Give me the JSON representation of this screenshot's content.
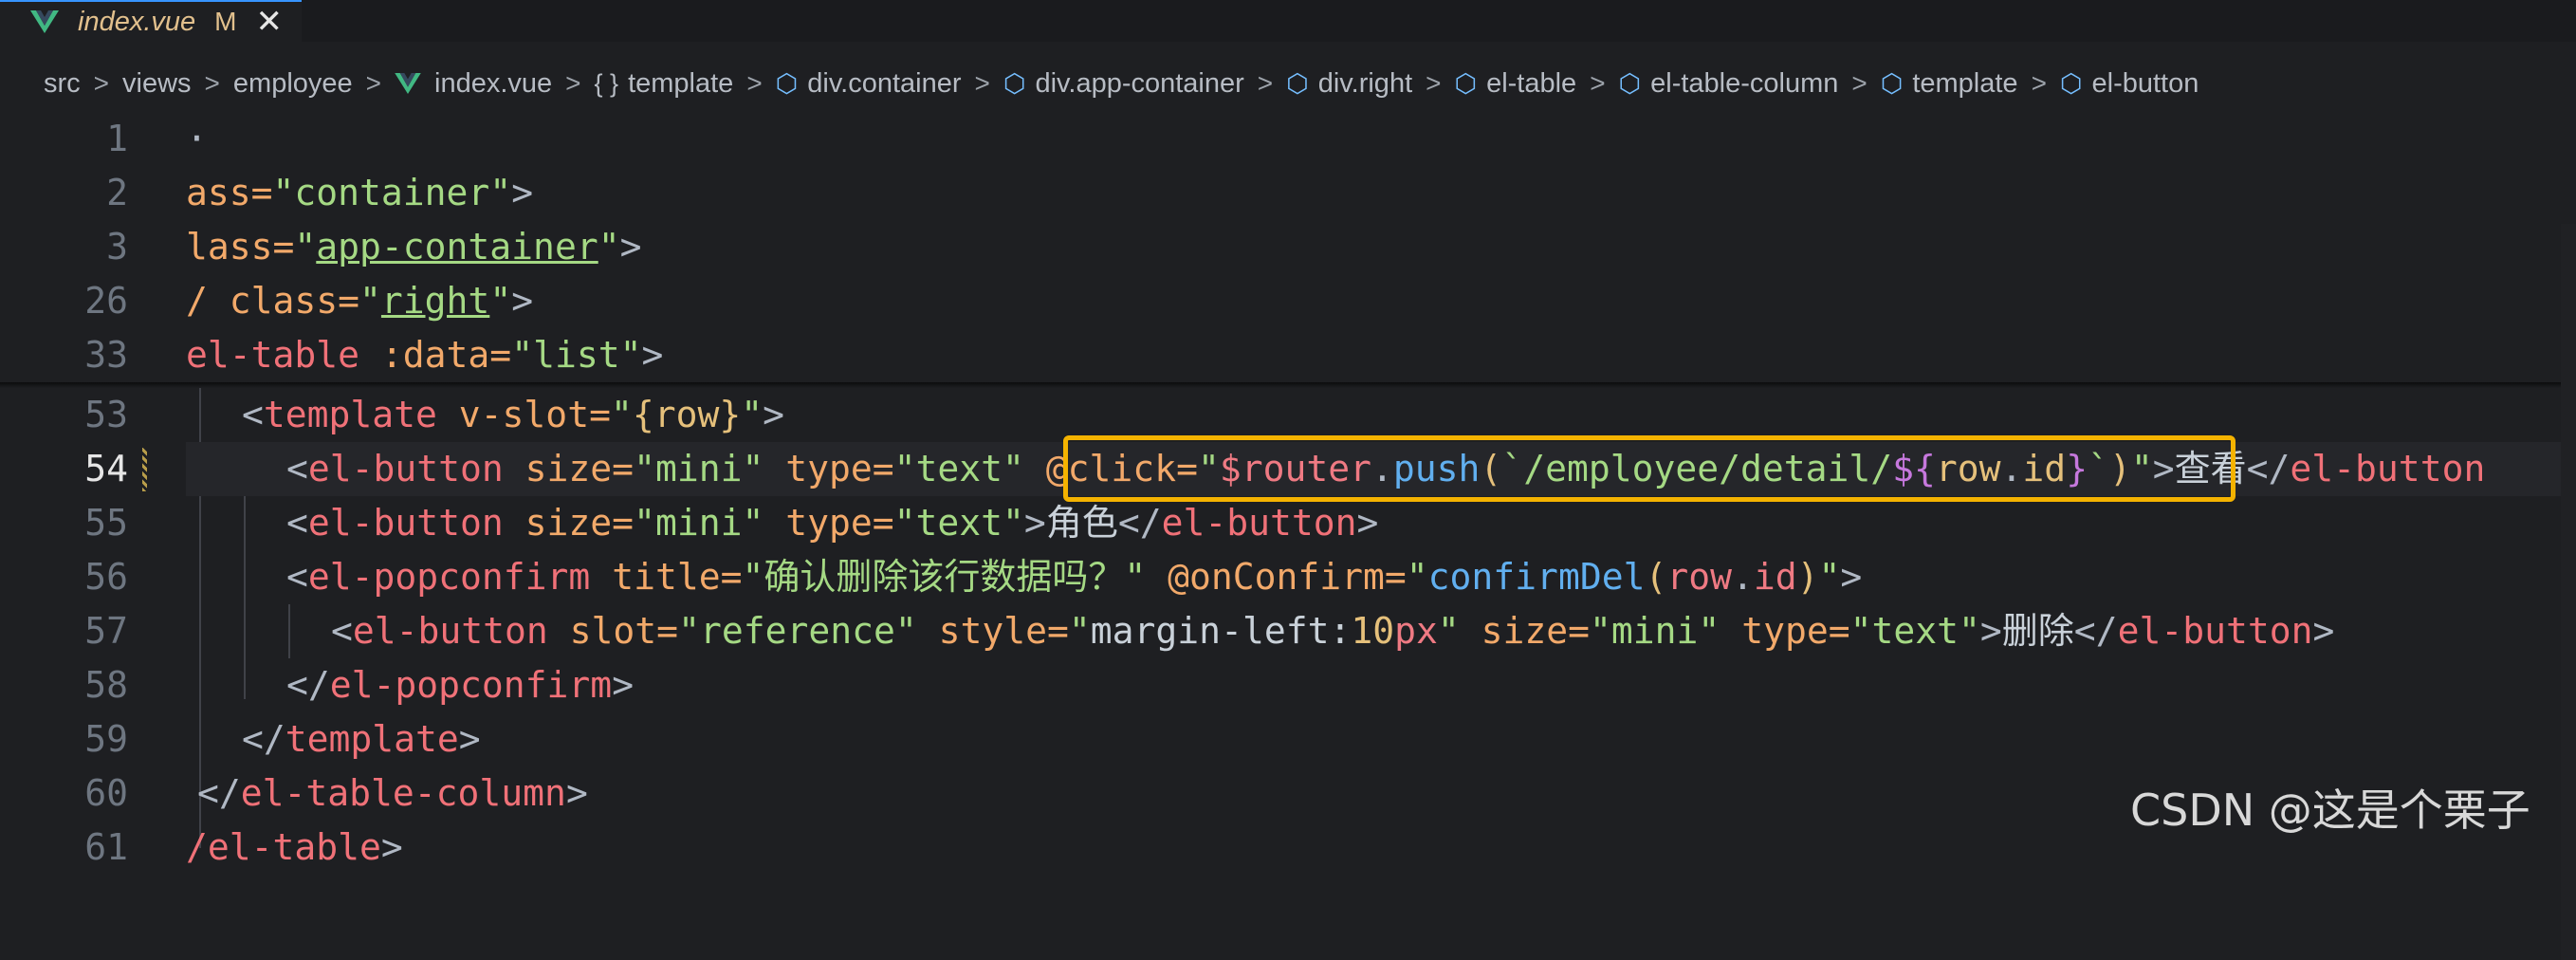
{
  "tab": {
    "title": "index.vue",
    "status": "M",
    "close_glyph": "✕"
  },
  "breadcrumb": [
    {
      "label": "src",
      "icon": ""
    },
    {
      "label": "views",
      "icon": ""
    },
    {
      "label": "employee",
      "icon": ""
    },
    {
      "label": "index.vue",
      "icon": "vue-logo-icon"
    },
    {
      "label": "template",
      "icon": "braces-icon",
      "icon_glyph": "{ }"
    },
    {
      "label": "div.container",
      "icon": "cube-icon",
      "icon_glyph": "⬡"
    },
    {
      "label": "div.app-container",
      "icon": "cube-icon",
      "icon_glyph": "⬡"
    },
    {
      "label": "div.right",
      "icon": "cube-icon",
      "icon_glyph": "⬡"
    },
    {
      "label": "el-table",
      "icon": "cube-icon",
      "icon_glyph": "⬡"
    },
    {
      "label": "el-table-column",
      "icon": "cube-icon",
      "icon_glyph": "⬡"
    },
    {
      "label": "template",
      "icon": "cube-icon",
      "icon_glyph": "⬡"
    },
    {
      "label": "el-button",
      "icon": "cube-icon",
      "icon_glyph": "⬡"
    }
  ],
  "breadcrumb_separator": ">",
  "line_numbers": [
    "1",
    "2",
    "3",
    "26",
    "33",
    "53",
    "54",
    "55",
    "56",
    "57",
    "58",
    "59",
    "60",
    "61"
  ],
  "code": {
    "l1": "·",
    "l2a": "ass=",
    "l2b": "\"container\"",
    "l2c": ">",
    "l3a": "lass=",
    "l3b": "\"",
    "l3c": "app-container",
    "l3d": "\"",
    "l3e": ">",
    "l26a": "/ class=",
    "l26b": "\"",
    "l26c": "right",
    "l26d": "\"",
    "l26e": ">",
    "l33a": "el-table",
    "l33b": " :data=",
    "l33c": "\"list\"",
    "l33d": ">",
    "l53a": "<",
    "l53b": "template",
    "l53c": " v-slot=",
    "l53d": "\"",
    "l53e": "{row}",
    "l53f": "\"",
    "l53g": ">",
    "l54_open": "<",
    "l54_tag": "el-button",
    "l54_size": " size=",
    "l54_sizev": "\"mini\"",
    "l54_type": " type=",
    "l54_typev": "\"text\"",
    "l54_click": " @click=",
    "l54_q1": "\"",
    "l54_router": "$router",
    "l54_dot": ".",
    "l54_push": "push",
    "l54_paren": "(",
    "l54_bt": "`",
    "l54_path": "/employee/detail/",
    "l54_dollar": "${",
    "l54_row": "row",
    "l54_dot2": ".",
    "l54_id": "id",
    "l54_close": "}",
    "l54_bt2": "`",
    "l54_paren2": ")",
    "l54_q2": "\"",
    "l54_gt": ">",
    "l54_text": "查看",
    "l54_end": "</",
    "l54_endtag": "el-button",
    "l55_open": "<",
    "l55_tag": "el-button",
    "l55_size": " size=",
    "l55_sizev": "\"mini\"",
    "l55_type": " type=",
    "l55_typev": "\"text\"",
    "l55_gt": ">",
    "l55_text": "角色",
    "l55_end": "</",
    "l55_endtag": "el-button",
    "l55_gt2": ">",
    "l56_open": "<",
    "l56_tag": "el-popconfirm",
    "l56_title": " title=",
    "l56_titlev": "\"确认删除该行数据吗？\"",
    "l56_on": " @onConfirm=",
    "l56_q1": "\"",
    "l56_fn": "confirmDel",
    "l56_p1": "(",
    "l56_row": "row",
    "l56_dot": ".",
    "l56_id": "id",
    "l56_p2": ")",
    "l56_q2": "\"",
    "l56_gt": ">",
    "l57_open": "<",
    "l57_tag": "el-button",
    "l57_slot": " slot=",
    "l57_slotv": "\"reference\"",
    "l57_style": " style=",
    "l57_q1": "\"",
    "l57_ml": "margin-left:",
    "l57_num": "10",
    "l57_px": "px",
    "l57_q2": "\"",
    "l57_size": " size=",
    "l57_sizev": "\"mini\"",
    "l57_type": " type=",
    "l57_typev": "\"text\"",
    "l57_gt": ">",
    "l57_text": "删除",
    "l57_end": "</",
    "l57_endtag": "el-button",
    "l57_gt2": ">",
    "l58_open": "</",
    "l58_tag": "el-popconfirm",
    "l58_gt": ">",
    "l59_open": "</",
    "l59_tag": "template",
    "l59_gt": ">",
    "l60_open": "</",
    "l60_tag": "el-table-column",
    "l60_gt": ">",
    "l61a": "/el-table",
    "l61b": ">"
  },
  "watermark": "CSDN @这是个栗子",
  "colors": {
    "tag": "#f07178",
    "string": "#a5d984",
    "attribute": "#f2a96a",
    "highlight_box": "#f5b300"
  }
}
